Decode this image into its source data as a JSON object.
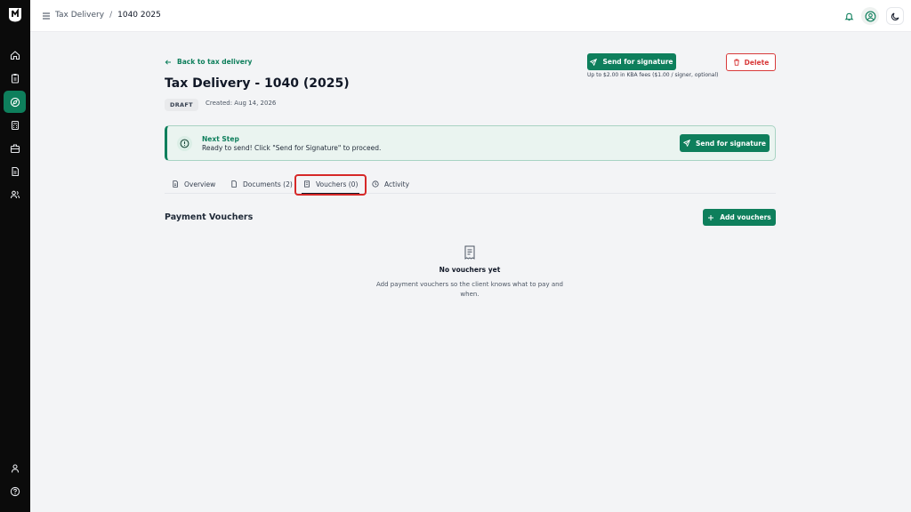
{
  "header": {
    "breadcrumb": [
      "Tax Delivery",
      "/",
      "1040 2025"
    ]
  },
  "page": {
    "back_link": "Back to tax delivery",
    "title": "Tax Delivery - 1040 (2025)",
    "status": "DRAFT",
    "created": "Created: Aug 14, 2026",
    "send_button": "Send for signature",
    "fee_note": "Up to $2.00 in KBA fees ($1.00 / signer, optional)",
    "delete_button": "Delete"
  },
  "next_step": {
    "title": "Next Step",
    "text": "Ready to send! Click \"Send for Signature\" to proceed.",
    "button": "Send for signature"
  },
  "tabs": [
    {
      "label": "Overview",
      "icon": "document-icon"
    },
    {
      "label": "Documents (2)",
      "icon": "file-icon"
    },
    {
      "label": "Vouchers (0)",
      "icon": "receipt-icon",
      "active": true
    },
    {
      "label": "Activity",
      "icon": "clock-icon"
    }
  ],
  "vouchers": {
    "title": "Payment Vouchers",
    "add_button": "Add vouchers",
    "empty_title": "No vouchers yet",
    "empty_text": "Add payment vouchers so the client knows what to pay and when."
  },
  "sidebar": {
    "icons": [
      "home-icon",
      "clipboard-icon",
      "compass-icon",
      "calculator-icon",
      "briefcase-icon",
      "document-icon",
      "users-icon",
      "user-icon",
      "help-icon"
    ],
    "active": "compass-icon"
  },
  "colors": {
    "accent": "#0e7f5c",
    "danger": "#d83a3a",
    "sidebar": "#0b0b0b",
    "highlight": "#d62828"
  }
}
